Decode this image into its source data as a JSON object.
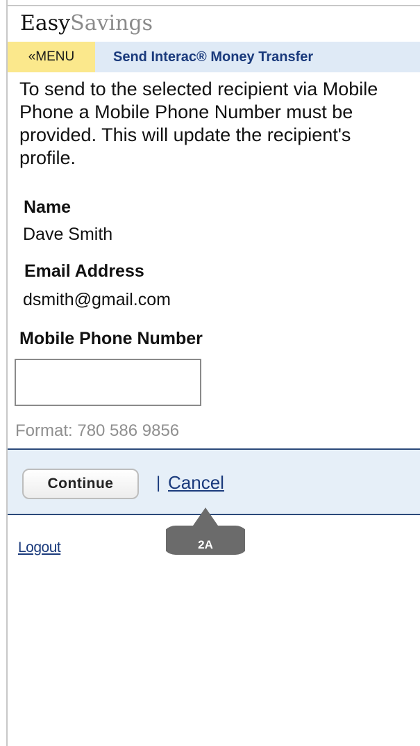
{
  "app": {
    "logo_part1": "Easy",
    "logo_part2": "Savings"
  },
  "nav": {
    "menu_label": "«MENU",
    "title": "Send Interac® Money Transfer"
  },
  "intro_text": "To send to the selected recipient via Mobile Phone a Mobile Phone Number must be provided. This will update the recipient's profile.",
  "recipient": {
    "name_label": "Name",
    "name_value": "Dave Smith",
    "email_label": "Email Address",
    "email_value": "dsmith@gmail.com"
  },
  "phone": {
    "label": "Mobile Phone Number",
    "value": "",
    "format_hint": "Format: 780 586 9856"
  },
  "actions": {
    "continue_label": "Continue",
    "separator": "|",
    "cancel_label": "Cancel"
  },
  "footer": {
    "logout_label": "Logout"
  },
  "annotation": {
    "label": "2A"
  },
  "colors": {
    "nav_background": "#dfeaf6",
    "menu_background": "#fbe88c",
    "link_blue": "#1a3a7c",
    "action_bar_background": "#e6eff8",
    "annotation_gray": "#6b6b6b"
  }
}
